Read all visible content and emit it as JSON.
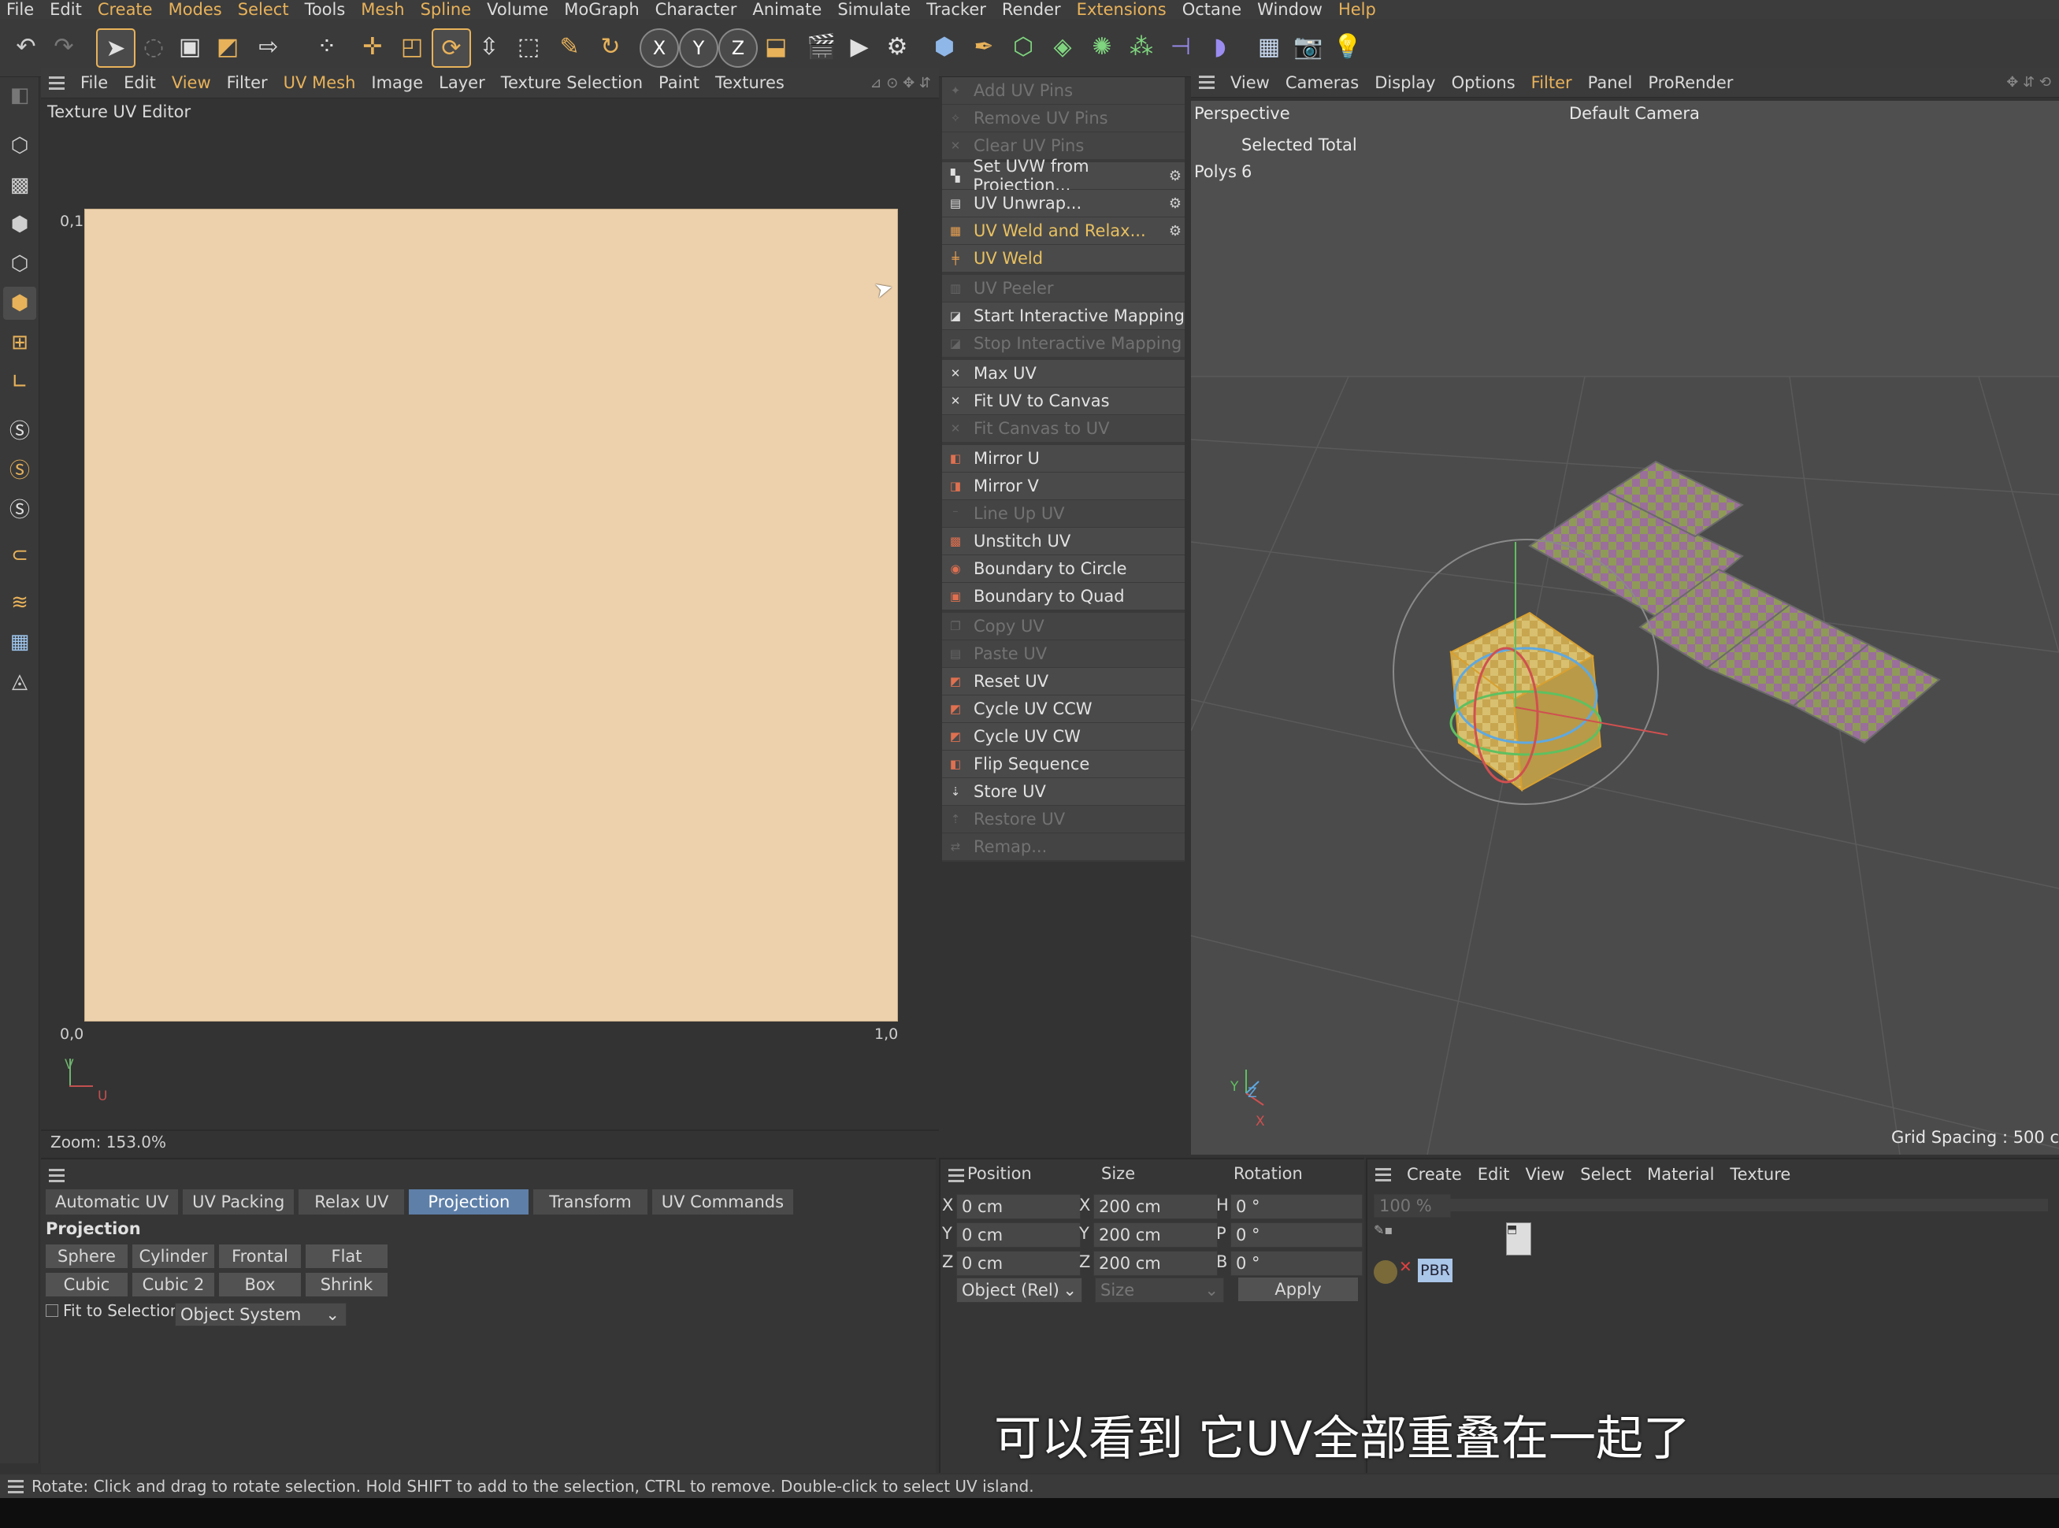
{
  "menubar": {
    "items": [
      "File",
      "Edit",
      "Create",
      "Modes",
      "Select",
      "Tools",
      "Mesh",
      "Spline",
      "Volume",
      "MoGraph",
      "Character",
      "Animate",
      "Simulate",
      "Tracker",
      "Render",
      "Extensions",
      "Octane",
      "Window",
      "Help"
    ]
  },
  "uv_editor": {
    "menu": [
      "File",
      "Edit",
      "View",
      "Filter",
      "UV Mesh",
      "Image",
      "Layer",
      "Texture Selection",
      "Paint",
      "Textures"
    ],
    "title": "Texture UV Editor",
    "label_top_left": "0,1",
    "label_bottom_left": "0,0",
    "label_bottom_right": "1,0",
    "axis_v": "V",
    "axis_u": "U",
    "zoom": "Zoom: 153.0%"
  },
  "uv_commands": [
    {
      "label": "Add UV Pins",
      "enabled": false
    },
    {
      "label": "Remove UV Pins",
      "enabled": false
    },
    {
      "label": "Clear UV Pins",
      "enabled": false
    },
    {
      "label": "Set UVW from Projection...",
      "enabled": true
    },
    {
      "label": "UV Unwrap...",
      "enabled": true
    },
    {
      "label": "UV Weld and Relax...",
      "enabled": true
    },
    {
      "label": "UV Weld",
      "enabled": true
    },
    {
      "label": "UV Peeler",
      "enabled": false
    },
    {
      "label": "Start Interactive Mapping",
      "enabled": true
    },
    {
      "label": "Stop Interactive Mapping",
      "enabled": false
    },
    {
      "label": "Max UV",
      "enabled": true
    },
    {
      "label": "Fit UV to Canvas",
      "enabled": true
    },
    {
      "label": "Fit Canvas to UV",
      "enabled": false
    },
    {
      "label": "Mirror U",
      "enabled": true
    },
    {
      "label": "Mirror V",
      "enabled": true
    },
    {
      "label": "Line Up UV",
      "enabled": false
    },
    {
      "label": "Unstitch UV",
      "enabled": true
    },
    {
      "label": "Boundary to Circle",
      "enabled": true
    },
    {
      "label": "Boundary to Quad",
      "enabled": true
    },
    {
      "label": "Copy UV",
      "enabled": false
    },
    {
      "label": "Paste UV",
      "enabled": false
    },
    {
      "label": "Reset UV",
      "enabled": true
    },
    {
      "label": "Cycle UV CCW",
      "enabled": true
    },
    {
      "label": "Cycle UV CW",
      "enabled": true
    },
    {
      "label": "Flip Sequence",
      "enabled": true
    },
    {
      "label": "Store UV",
      "enabled": true
    },
    {
      "label": "Restore UV",
      "enabled": false
    },
    {
      "label": "Remap...",
      "enabled": false
    }
  ],
  "viewport": {
    "menu": [
      "View",
      "Cameras",
      "Display",
      "Options",
      "Filter",
      "Panel",
      "ProRender"
    ],
    "name": "Perspective",
    "camera": "Default Camera",
    "selected_total": "Selected Total",
    "polys_label": "Polys",
    "polys_value": "6",
    "grid_spacing": "Grid Spacing : 500 c",
    "axis_y": "Y",
    "axis_z": "Z",
    "axis_x": "X"
  },
  "bottom_tabs": {
    "items": [
      "Automatic UV",
      "UV Packing",
      "Relax UV",
      "Projection",
      "Transform",
      "UV Commands"
    ],
    "active": "Projection"
  },
  "projection": {
    "title": "Projection",
    "buttons": [
      "Sphere",
      "Cylinder",
      "Frontal",
      "Flat",
      "Cubic",
      "Cubic 2",
      "Box",
      "Shrink"
    ],
    "fit_label": "Fit to Selection",
    "system_select": "Object System"
  },
  "coords": {
    "position_header": "Position",
    "size_header": "Size",
    "rotation_header": "Rotation",
    "rows": [
      {
        "axis": "X",
        "pos": "0 cm",
        "size_axis": "X",
        "size": "200 cm",
        "rot_axis": "H",
        "rot": "0 °"
      },
      {
        "axis": "Y",
        "pos": "0 cm",
        "size_axis": "Y",
        "size": "200 cm",
        "rot_axis": "P",
        "rot": "0 °"
      },
      {
        "axis": "Z",
        "pos": "0 cm",
        "size_axis": "Z",
        "size": "200 cm",
        "rot_axis": "B",
        "rot": "0 °"
      }
    ],
    "mode_select": "Object (Rel)",
    "size_select": "Size",
    "apply": "Apply"
  },
  "material": {
    "menu": [
      "Create",
      "Edit",
      "View",
      "Select",
      "Material",
      "Texture"
    ],
    "zoom": "100 %",
    "tag": "PBR"
  },
  "subtitle": "可以看到 它UV全部重叠在一起了",
  "status": "Rotate: Click and drag to rotate selection. Hold SHIFT to add to the selection, CTRL to remove. Double-click to select UV island.",
  "colors": {
    "accent": "#e8b25a",
    "uv_canvas": "#edd1ac",
    "tab_active": "#5e7fa8"
  }
}
